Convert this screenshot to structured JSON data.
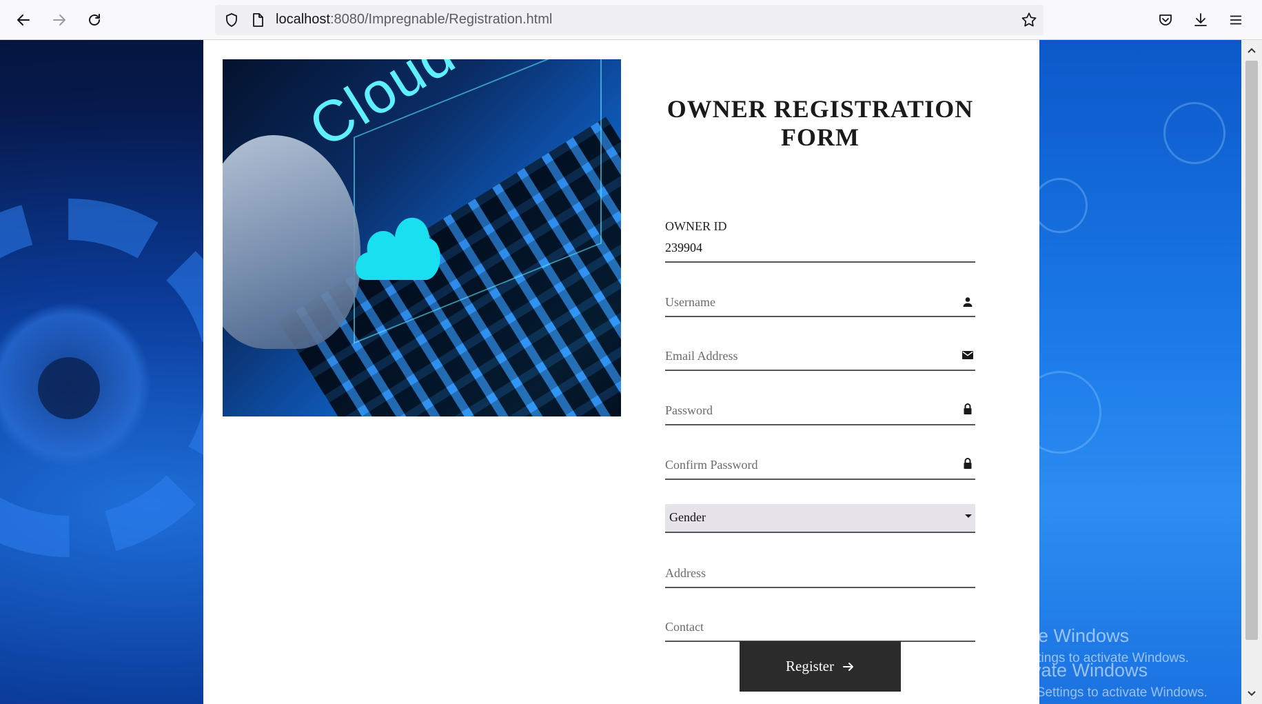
{
  "browser": {
    "url_host": "localhost",
    "url_path": ":8080/Impregnable/Registration.html"
  },
  "form": {
    "title_line1": "OWNER REGISTRATION",
    "title_line2": "FORM",
    "owner_id_label": "OWNER ID",
    "owner_id_value": "239904",
    "username_placeholder": "Username",
    "email_placeholder": "Email Address",
    "password_placeholder": "Password",
    "confirm_password_placeholder": "Confirm Password",
    "gender_selected": "Gender",
    "address_placeholder": "Address",
    "contact_placeholder": "Contact",
    "register_label": "Register"
  },
  "hero": {
    "cloud_text": "Cloud"
  },
  "watermark": {
    "title": "Activate Windows",
    "subtitle": "Go to Settings to activate Windows."
  },
  "icons": [
    "back-arrow-icon",
    "forward-arrow-icon",
    "reload-icon",
    "shield-icon",
    "page-icon",
    "star-icon",
    "pocket-icon",
    "download-icon",
    "menu-icon",
    "user-icon",
    "envelope-icon",
    "lock-icon",
    "caret-down-icon",
    "arrow-right-icon"
  ]
}
